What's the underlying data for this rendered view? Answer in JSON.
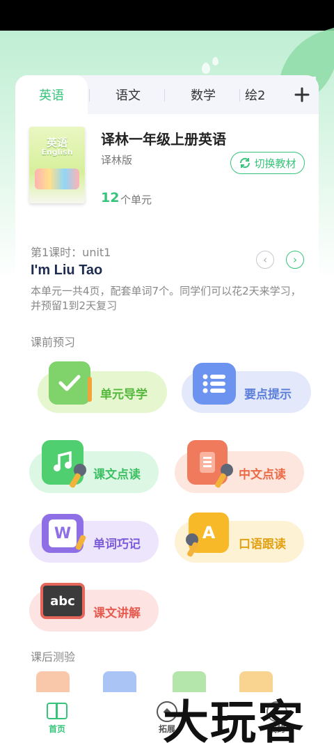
{
  "tabs": {
    "items": [
      {
        "label": "英语",
        "active": true
      },
      {
        "label": "语文",
        "active": false
      },
      {
        "label": "数学",
        "active": false
      },
      {
        "label": "绘2",
        "active": false
      }
    ],
    "add_icon": "plus-icon"
  },
  "book": {
    "cover_title": "英语",
    "cover_sub": "English",
    "title": "译林一年级上册英语",
    "edition": "译林版",
    "switch_label": "切换教材",
    "unit_count": "12",
    "unit_label": "个单元"
  },
  "lesson": {
    "index": "第1课时：unit1",
    "title": "I'm Liu Tao",
    "description": "本单元一共4页，配套单词7个。同学们可以花2天来学习，并预留1到2天复习"
  },
  "preview": {
    "section_title": "课前预习",
    "items": [
      {
        "label": "单元导学",
        "icon": "check-book-icon"
      },
      {
        "label": "要点提示",
        "icon": "list-icon"
      },
      {
        "label": "课文点读",
        "icon": "music-note-icon"
      },
      {
        "label": "中文点读",
        "icon": "document-icon"
      },
      {
        "label": "单词巧记",
        "icon": "letter-w-icon"
      },
      {
        "label": "口语跟读",
        "icon": "letter-a-icon"
      },
      {
        "label": "课文讲解",
        "icon": "blackboard-icon",
        "icon_text": "abc"
      }
    ]
  },
  "after": {
    "section_title": "课后测验"
  },
  "bottom_nav": {
    "items": [
      {
        "label": "首页",
        "icon": "book-open-icon",
        "active": true
      },
      {
        "label": "拓展",
        "icon": "compass-icon",
        "active": false
      },
      {
        "label": "我的",
        "icon": "profile-icon",
        "active": false
      }
    ]
  },
  "watermark": "大玩客",
  "colors": {
    "accent": "#35c47a",
    "title_dark": "#1d2b4f",
    "muted": "#888888"
  }
}
